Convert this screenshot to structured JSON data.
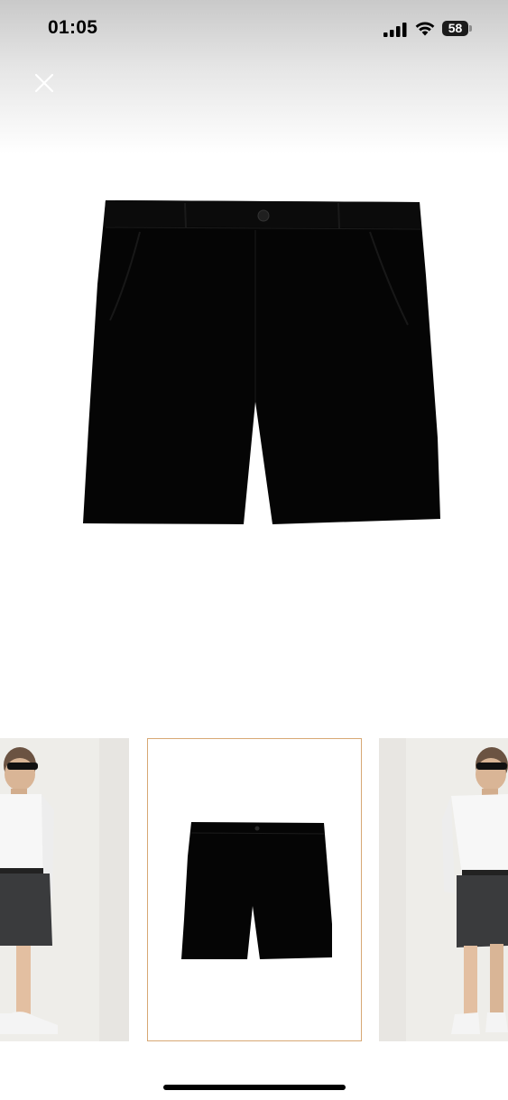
{
  "status_bar": {
    "time": "01:05",
    "battery_level": "58",
    "icons": [
      "cellular-signal-icon",
      "wifi-icon",
      "battery-icon"
    ]
  },
  "viewer": {
    "close_icon": "close-icon",
    "main_image_subject": "black-shorts",
    "thumbnails": [
      {
        "subject": "model-wearing-shorts-front",
        "selected": false
      },
      {
        "subject": "black-shorts-flat",
        "selected": true
      },
      {
        "subject": "model-wearing-shorts-side",
        "selected": false
      }
    ]
  },
  "colors": {
    "accent_selected_border": "#d7a874",
    "product": "#050505"
  }
}
